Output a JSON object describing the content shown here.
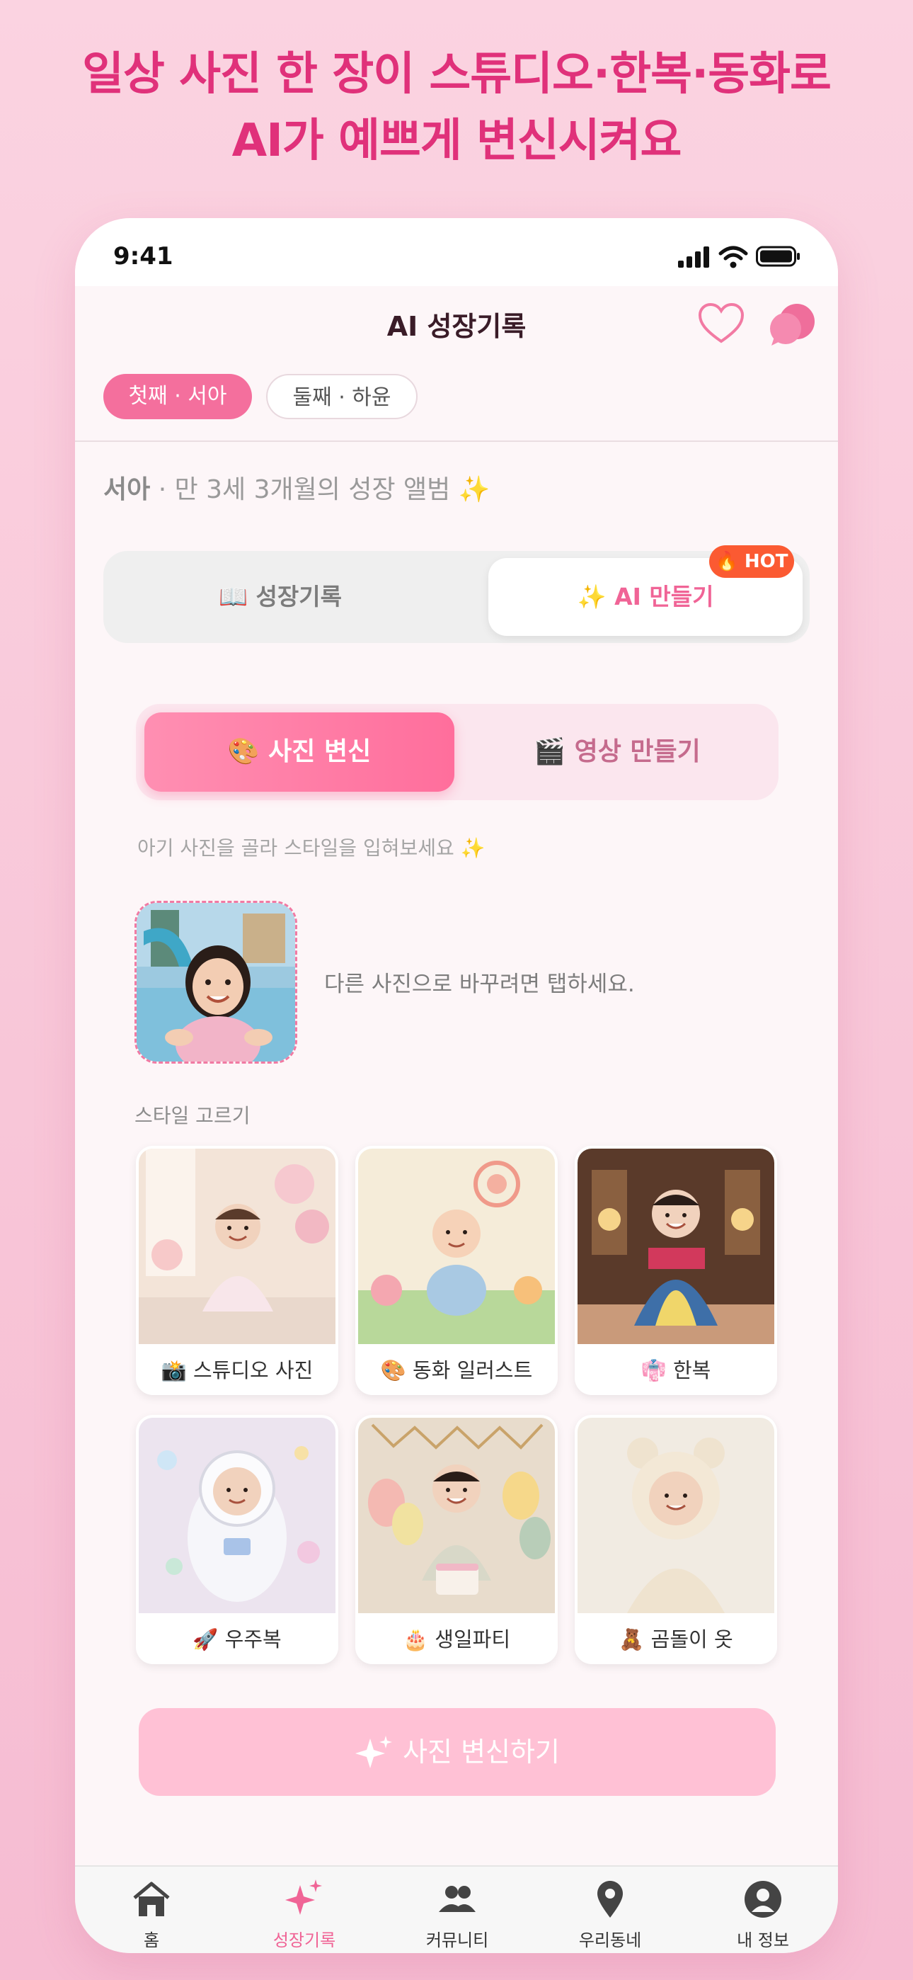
{
  "headline": {
    "line1": "일상 사진 한 장이 스튜디오·한복·동화로",
    "line2": "AI가 예쁘게 변신시켜요"
  },
  "status_bar": {
    "time": "9:41"
  },
  "app_bar": {
    "title": "AI 성장기록",
    "actions": [
      "heart-icon",
      "chat-icon"
    ]
  },
  "child_tabs": [
    {
      "label": "첫째 · 서아",
      "selected": true
    },
    {
      "label": "둘째 · 하윤",
      "selected": false
    }
  ],
  "album": {
    "name": "서아",
    "suffix": " · 만 3세 3개월의 성장 앨범 ✨"
  },
  "main_segment": {
    "left": "📖 성장기록",
    "right": "✨ AI 만들기",
    "badge": "🔥 HOT",
    "selected": "right"
  },
  "mode_segment": {
    "photo": "🎨 사진 변신",
    "video": "🎬 영상 만들기",
    "selected": "photo"
  },
  "hint": "아기 사진을 골라 스타일을 입혀보세요 ✨",
  "photo": {
    "description": "다른 사진으로 바꾸려면 탭하세요."
  },
  "styles": {
    "label": "스타일 고르기",
    "items": [
      {
        "label": "📸 스튜디오 사진"
      },
      {
        "label": "🎨 동화 일러스트"
      },
      {
        "label": "👘 한복"
      },
      {
        "label": "🚀 우주복"
      },
      {
        "label": "🎂 생일파티"
      },
      {
        "label": "🧸 곰돌이 옷"
      }
    ]
  },
  "cta": {
    "label": "사진 변신하기"
  },
  "tab_bar": [
    {
      "label": "홈",
      "icon": "home-icon"
    },
    {
      "label": "성장기록",
      "icon": "sparkle-icon",
      "active": true
    },
    {
      "label": "커뮤니티",
      "icon": "people-icon"
    },
    {
      "label": "우리동네",
      "icon": "location-pin-icon"
    },
    {
      "label": "내 정보",
      "icon": "profile-icon"
    }
  ],
  "colors": {
    "accent": "#f06496",
    "accent_strong": "#ff6e9c",
    "headline": "#e0317a",
    "hot_badge": "#fb5a32",
    "background": "#f8c6d8"
  }
}
